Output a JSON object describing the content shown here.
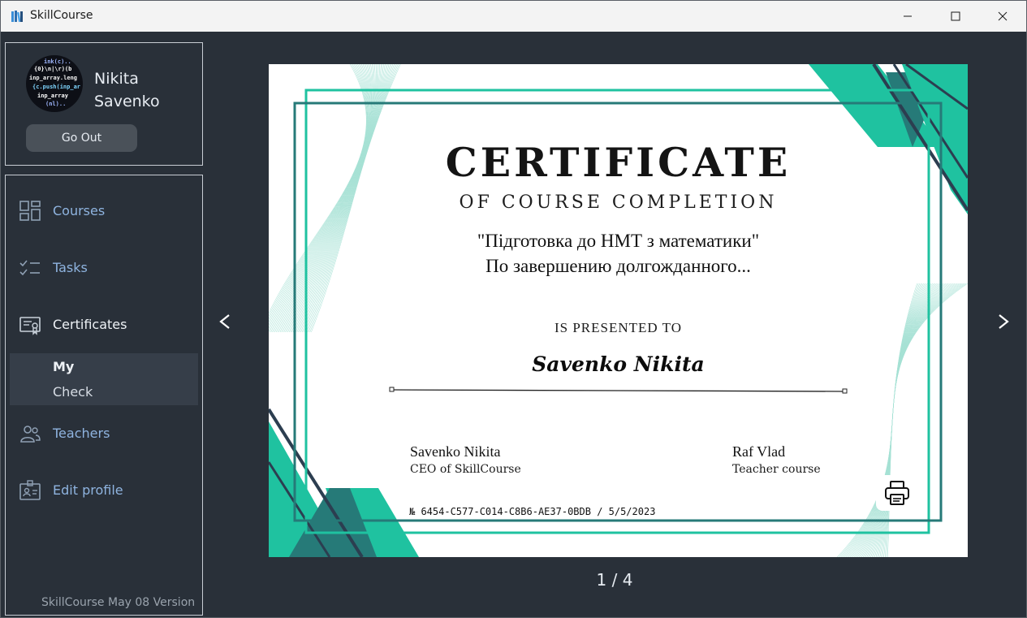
{
  "window": {
    "title": "SkillCourse",
    "icons": [
      "app-books-icon",
      "minimize-icon",
      "maximize-icon",
      "close-icon"
    ]
  },
  "profile": {
    "first_name": "Nikita",
    "last_name": "Savenko",
    "go_out_label": "Go Out"
  },
  "sidebar": {
    "items": [
      {
        "label": "Courses",
        "icon": "grid-icon"
      },
      {
        "label": "Tasks",
        "icon": "checklist-icon"
      },
      {
        "label": "Certificates",
        "icon": "certificate-icon"
      },
      {
        "label": "Teachers",
        "icon": "people-icon"
      },
      {
        "label": "Edit profile",
        "icon": "id-badge-icon"
      }
    ],
    "sub_items": [
      {
        "label": "My"
      },
      {
        "label": "Check"
      }
    ],
    "version": "SkillCourse  May 08 Version"
  },
  "certificate": {
    "title": "CERTIFICATE",
    "subtitle": "OF COURSE COMPLETION",
    "course": "\"Підготовка до НМТ з математики\"",
    "description": "По завершению долгожданного...",
    "presented_to": "IS PRESENTED TO",
    "recipient": "Savenko Nikita",
    "signer_left": "Savenko Nikita",
    "signer_left_role": "CEO of SkillCourse",
    "signer_right": "Raf Vlad",
    "signer_right_role": "Teacher course",
    "number": "№ 6454-C577-C014-C8B6-AE37-0BDB / 5/5/2023"
  },
  "pager": {
    "text": "1 / 4"
  },
  "nav_arrows": {
    "prev": "<",
    "next": ">"
  },
  "colors": {
    "background": "#293039",
    "accent_teal": "#1fc2a0",
    "dark_teal": "#267a78",
    "navy": "#2c3e50",
    "link_blue": "#8fb4e0"
  }
}
